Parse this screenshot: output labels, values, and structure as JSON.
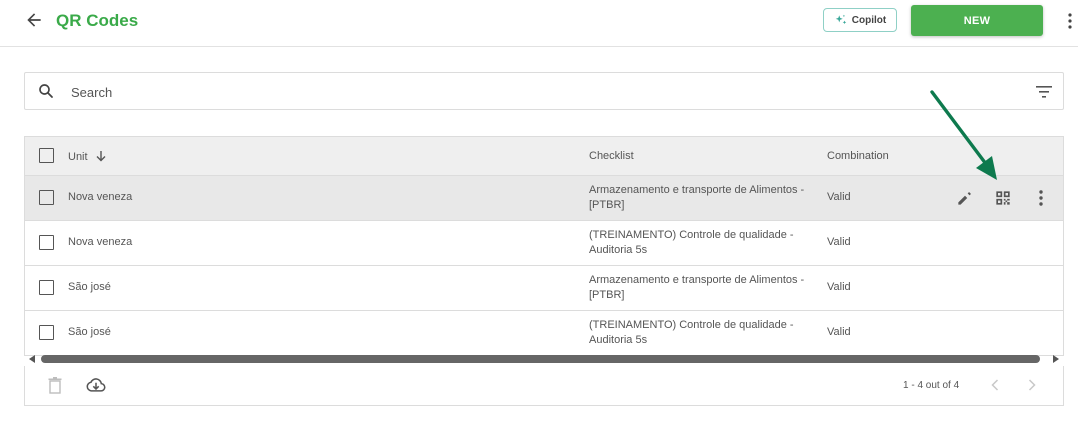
{
  "header": {
    "title": "QR Codes",
    "copilot_label": "Copilot",
    "new_label": "NEW"
  },
  "search": {
    "placeholder": "Search",
    "value": ""
  },
  "table": {
    "columns": [
      "Unit",
      "Checklist",
      "Combination"
    ],
    "rows": [
      {
        "unit": "Nova veneza",
        "checklist": "Armazenamento e transporte de Alimentos - [PTBR]",
        "combination": "Valid"
      },
      {
        "unit": "Nova veneza",
        "checklist": "(TREINAMENTO) Controle de qualidade - Auditoria 5s",
        "combination": "Valid"
      },
      {
        "unit": "São josé",
        "checklist": "Armazenamento e transporte de Alimentos - [PTBR]",
        "combination": "Valid"
      },
      {
        "unit": "São josé",
        "checklist": "(TREINAMENTO) Controle de qualidade - Auditoria 5s",
        "combination": "Valid"
      }
    ]
  },
  "pagination": {
    "summary": "1 - 4 out of 4"
  },
  "colors": {
    "brand_green": "#3aaa49",
    "button_green": "#4cb050",
    "annotation_arrow": "#0e7a4e"
  }
}
